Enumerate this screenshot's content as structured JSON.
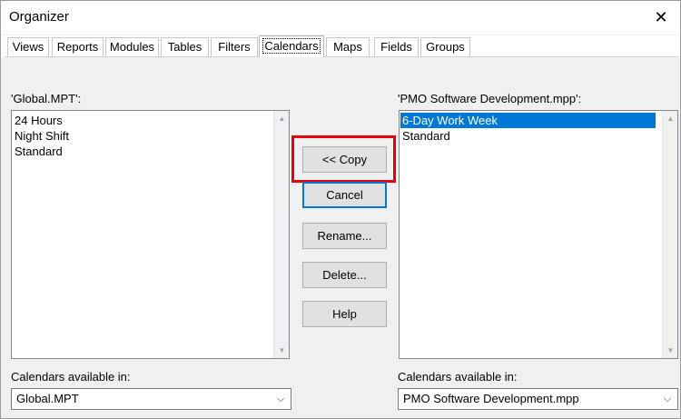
{
  "window": {
    "title": "Organizer",
    "close_glyph": "✕"
  },
  "tabs": [
    {
      "label": "Views",
      "active": false
    },
    {
      "label": "Reports",
      "active": false
    },
    {
      "label": "Modules",
      "active": false
    },
    {
      "label": "Tables",
      "active": false
    },
    {
      "label": "Filters",
      "active": false
    },
    {
      "label": "Calendars",
      "active": true
    },
    {
      "label": "Maps",
      "active": false
    },
    {
      "label": "Fields",
      "active": false
    },
    {
      "label": "Groups",
      "active": false
    }
  ],
  "left": {
    "header": "'Global.MPT':",
    "items": [
      "24 Hours",
      "Night Shift",
      "Standard"
    ],
    "available_label": "Calendars available in:",
    "available_value": "Global.MPT"
  },
  "right": {
    "header": "'PMO Software Development.mpp':",
    "items": [
      "6-Day Work Week",
      "Standard"
    ],
    "selected_item": "6-Day Work Week",
    "available_label": "Calendars available in:",
    "available_value": "PMO Software Development.mpp"
  },
  "buttons": {
    "copy": "<< Copy",
    "cancel": "Cancel",
    "rename": "Rename...",
    "delete": "Delete...",
    "help": "Help"
  },
  "icons": {
    "scroll_up": "up-arrow-icon",
    "scroll_down": "down-arrow-icon",
    "dropdown": "chevron-down-icon",
    "close": "close-icon"
  },
  "colors": {
    "selection": "#0078d7",
    "highlight_box": "#e8000b"
  }
}
